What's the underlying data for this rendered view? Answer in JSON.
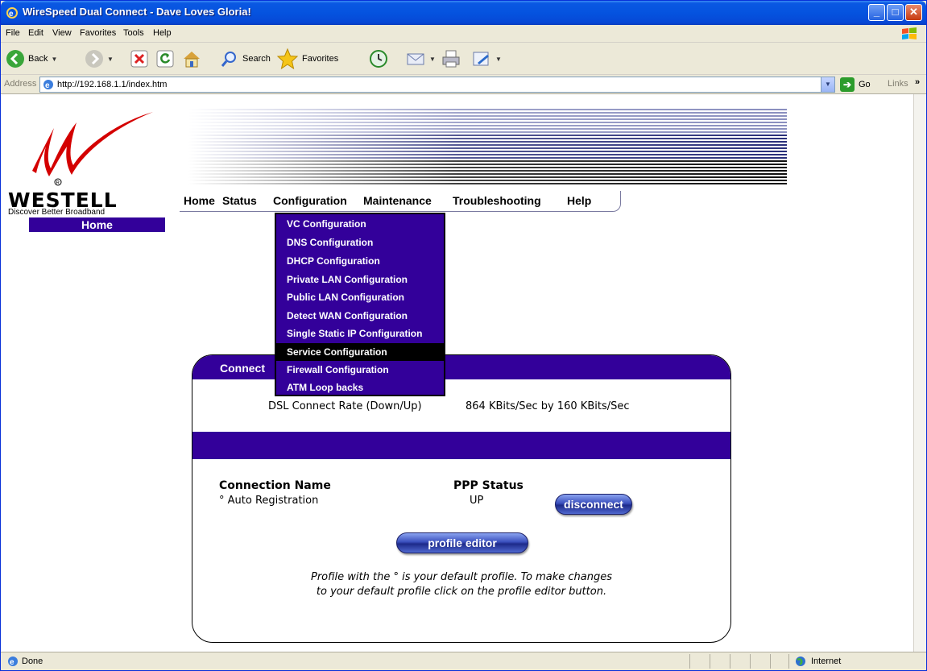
{
  "window": {
    "title": "WireSpeed Dual Connect - Dave Loves Gloria!"
  },
  "menubar": {
    "items": [
      "File",
      "Edit",
      "View",
      "Favorites",
      "Tools",
      "Help"
    ]
  },
  "toolbar": {
    "back": "Back",
    "search": "Search",
    "favorites": "Favorites"
  },
  "address": {
    "label": "Address",
    "url": "http://192.168.1.1/index.htm",
    "go": "Go",
    "links": "Links"
  },
  "logo": {
    "brand": "WESTELL",
    "tagline": "Discover  Better Broadband"
  },
  "nav": {
    "items": [
      "Home",
      "Status",
      "Configuration",
      "Maintenance",
      "Troubleshooting",
      "Help"
    ]
  },
  "sidebar": {
    "current": "Home"
  },
  "config_menu": {
    "items": [
      "VC Configuration",
      "DNS Configuration",
      "DHCP Configuration",
      "Private LAN Configuration",
      "Public LAN Configuration",
      "Detect WAN Configuration",
      "Single Static IP Configuration",
      "Service Configuration",
      "Firewall Configuration",
      "ATM Loop backs"
    ],
    "highlighted": "Service Configuration"
  },
  "panel": {
    "header": "Connect",
    "rate_label": "DSL Connect Rate (Down/Up)",
    "rate_value": "864 KBits/Sec by 160 KBits/Sec",
    "col_connection": "Connection Name",
    "col_status": "PPP Status",
    "connection_name": "° Auto Registration",
    "ppp_status": "UP",
    "disconnect_label": "disconnect",
    "profile_editor_label": "profile editor",
    "note_line1": "Profile with the ° is your default profile. To make changes",
    "note_line2": "to your default profile click on the profile editor button."
  },
  "statusbar": {
    "status": "Done",
    "zone": "Internet"
  },
  "colors": {
    "brand_purple": "#33009a",
    "xp_blue": "#0553df"
  }
}
